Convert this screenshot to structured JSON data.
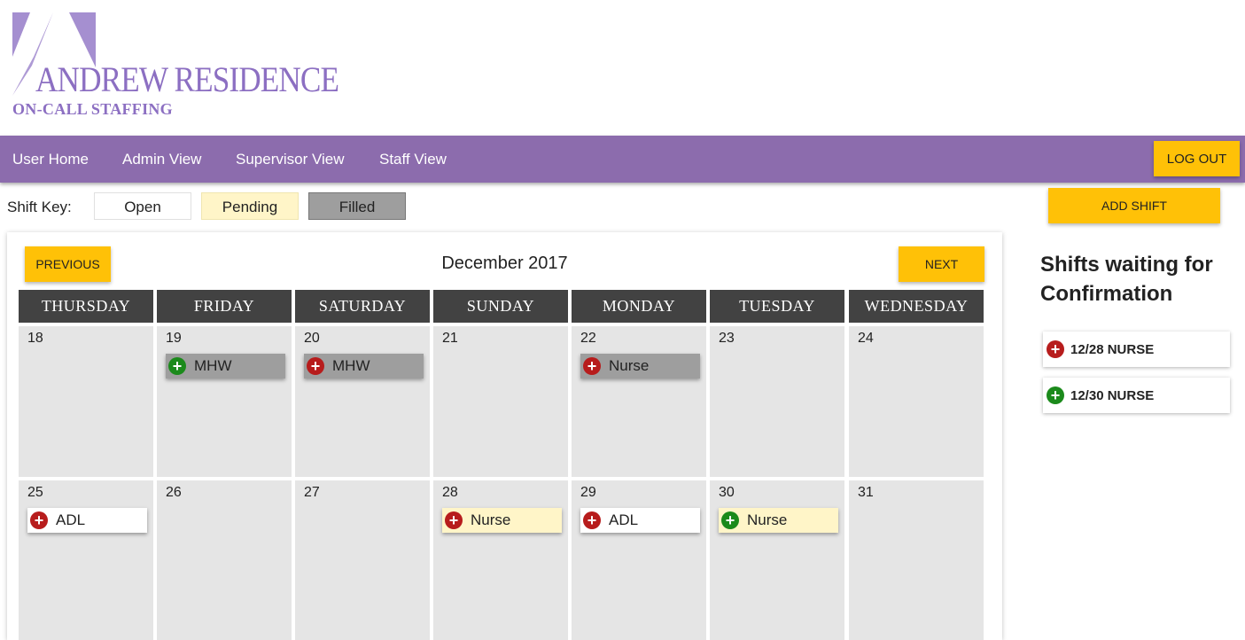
{
  "brand": {
    "title": "ANDREW RESIDENCE",
    "subtitle": "ON-CALL STAFFING",
    "color": "#8c6fc2"
  },
  "nav": {
    "links": [
      "User Home",
      "Admin View",
      "Supervisor View",
      "Staff View"
    ],
    "logout_label": "LOG OUT",
    "bar_color": "#8c6cad"
  },
  "shift_key": {
    "label": "Shift Key:",
    "items": [
      {
        "label": "Open",
        "color": "#ffffff"
      },
      {
        "label": "Pending",
        "color": "#fff5c8"
      },
      {
        "label": "Filled",
        "color": "#9e9e9e"
      }
    ]
  },
  "add_shift_label": "ADD SHIFT",
  "calendar": {
    "month_label": "December 2017",
    "previous_label": "PREVIOUS",
    "next_label": "NEXT",
    "day_headers": [
      "THURSDAY",
      "FRIDAY",
      "SATURDAY",
      "SUNDAY",
      "MONDAY",
      "TUESDAY",
      "WEDNESDAY"
    ],
    "weeks": [
      [
        {
          "day": "18",
          "shifts": []
        },
        {
          "day": "19",
          "shifts": [
            {
              "label": "MHW",
              "status": "filled",
              "icon": "add-green-icon"
            }
          ]
        },
        {
          "day": "20",
          "shifts": [
            {
              "label": "MHW",
              "status": "filled",
              "icon": "add-red-icon"
            }
          ]
        },
        {
          "day": "21",
          "shifts": []
        },
        {
          "day": "22",
          "shifts": [
            {
              "label": "Nurse",
              "status": "filled",
              "icon": "add-red-icon"
            }
          ]
        },
        {
          "day": "23",
          "shifts": []
        },
        {
          "day": "24",
          "shifts": []
        }
      ],
      [
        {
          "day": "25",
          "shifts": [
            {
              "label": "ADL",
              "status": "open",
              "icon": "add-red-icon"
            }
          ]
        },
        {
          "day": "26",
          "shifts": []
        },
        {
          "day": "27",
          "shifts": []
        },
        {
          "day": "28",
          "shifts": [
            {
              "label": "Nurse",
              "status": "pending",
              "icon": "add-red-icon"
            }
          ]
        },
        {
          "day": "29",
          "shifts": [
            {
              "label": "ADL",
              "status": "open",
              "icon": "add-red-icon"
            }
          ]
        },
        {
          "day": "30",
          "shifts": [
            {
              "label": "Nurse",
              "status": "pending",
              "icon": "add-green-icon"
            }
          ]
        },
        {
          "day": "31",
          "shifts": []
        }
      ]
    ]
  },
  "pending_panel": {
    "title": "Shifts waiting for Confirmation",
    "items": [
      {
        "label": "12/28 NURSE",
        "icon": "add-red-icon"
      },
      {
        "label": "12/30 NURSE",
        "icon": "add-green-icon"
      }
    ]
  },
  "colors": {
    "accent_yellow": "#ffc107",
    "header_dark": "#424242",
    "cell_gray": "#e5e5e5",
    "icon_red": "#b71c1c",
    "icon_green": "#1b8a1b"
  }
}
